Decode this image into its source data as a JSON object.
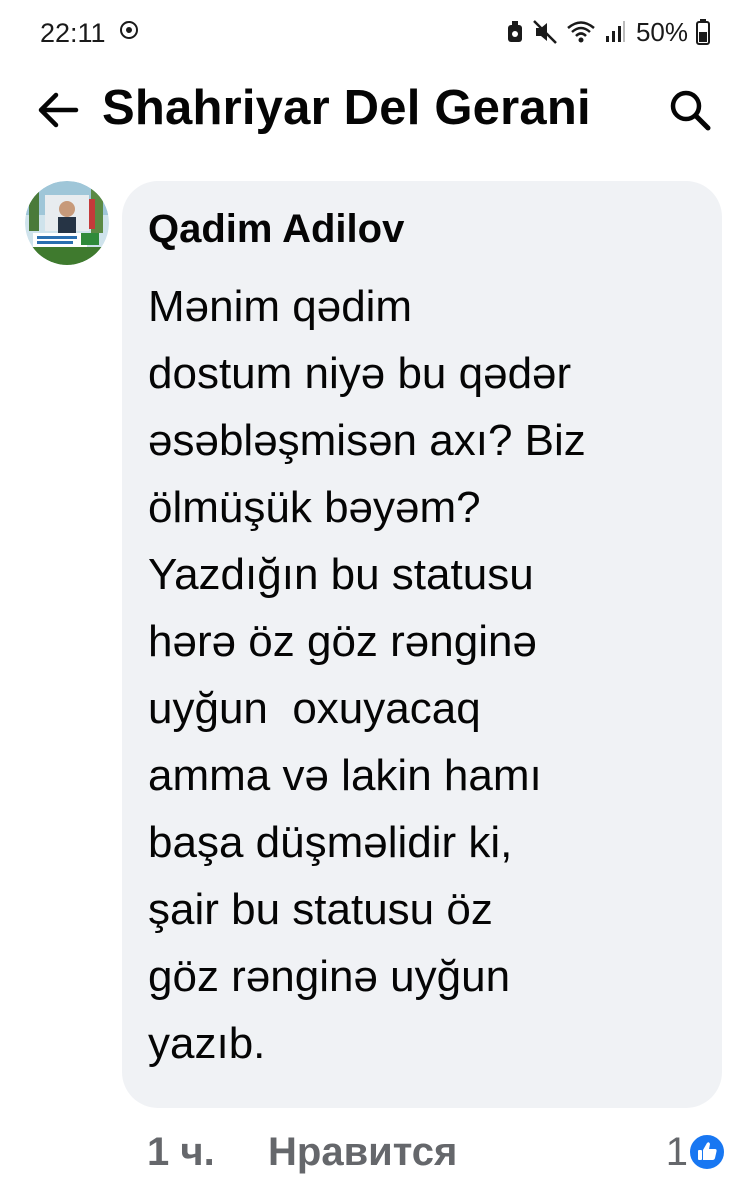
{
  "status_bar": {
    "time": "22:11",
    "battery": "50%"
  },
  "header": {
    "title": "Shahriyar Del Gerani",
    "back_icon": "arrow-left-icon",
    "search_icon": "search-icon"
  },
  "comment": {
    "author": "Qadim Adilov",
    "text": "Mənim qədim\ndostum niyə bu qədər\nəsəbləşmisən axı? Biz\nölmüşük bəyəm?\nYazdığın bu statusu\nhərə öz göz rənginə\nuyğun  oxuyacaq\namma və lakin hamı\nbaşa düşməlidir ki,\nşair bu statusu öz\ngöz rənginə uyğun\nyazıb.",
    "time_ago": "1 ч.",
    "like_label": "Нравится",
    "reaction_count": "1"
  },
  "colors": {
    "bubble_bg": "#f0f2f5",
    "meta_text": "#65676b",
    "like_blue": "#1877f2"
  }
}
